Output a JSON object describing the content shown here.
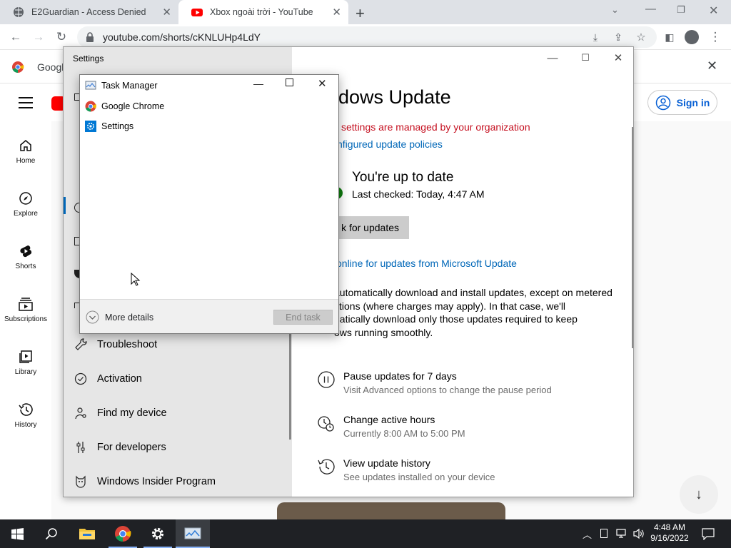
{
  "browser": {
    "tabs": [
      {
        "title": "E2Guardian - Access Denied"
      },
      {
        "title": "Xbox ngoài trời - YouTube"
      }
    ],
    "url": "youtube.com/shorts/cKNLUHp4LdY",
    "infobar_text": "Googl"
  },
  "youtube": {
    "nav": [
      {
        "label": "Home",
        "icon": "home-icon"
      },
      {
        "label": "Explore",
        "icon": "compass-icon"
      },
      {
        "label": "Shorts",
        "icon": "shorts-icon"
      },
      {
        "label": "Subscriptions",
        "icon": "subscriptions-icon"
      },
      {
        "label": "Library",
        "icon": "library-icon"
      },
      {
        "label": "History",
        "icon": "history-icon"
      }
    ],
    "sign_in": "Sign in",
    "partial_letter": "U"
  },
  "settings": {
    "window_title": "Settings",
    "sidebar": [
      {
        "label": "Troubleshoot",
        "icon": "wrench-icon"
      },
      {
        "label": "Activation",
        "icon": "check-circle-icon"
      },
      {
        "label": "Find my device",
        "icon": "person-location-icon"
      },
      {
        "label": "For developers",
        "icon": "sliders-icon"
      },
      {
        "label": "Windows Insider Program",
        "icon": "insider-cat-icon"
      }
    ],
    "page_title": "ndows Update",
    "managed_notice": "settings are managed by your organization",
    "policies_link": "nfigured update policies",
    "status_title": "You're up to date",
    "last_checked": "Last checked: Today, 4:47 AM",
    "check_button": "k for updates",
    "online_link": "online for updates from Microsoft Update",
    "description": [
      "automatically download and install updates, except on metered",
      "ctions (where charges may apply). In that case, we'll",
      "natically download only those updates required to keep",
      "ows running smoothly."
    ],
    "options": [
      {
        "title": "Pause updates for 7 days",
        "subtitle": "Visit Advanced options to change the pause period",
        "icon": "pause-icon"
      },
      {
        "title": "Change active hours",
        "subtitle": "Currently 8:00 AM to 5:00 PM",
        "icon": "active-hours-icon"
      },
      {
        "title": "View update history",
        "subtitle": "See updates installed on your device",
        "icon": "history-icon"
      }
    ],
    "colors": {
      "link": "#0067b8",
      "warning": "#c50f1f",
      "success": "#107c10"
    }
  },
  "task_manager": {
    "title": "Task Manager",
    "apps": [
      {
        "name": "Google Chrome",
        "icon": "chrome-icon"
      },
      {
        "name": "Settings",
        "icon": "settings-gear-icon"
      }
    ],
    "more_details": "More details",
    "end_task": "End task"
  },
  "taskbar": {
    "time": "4:48 AM",
    "date": "9/16/2022"
  }
}
